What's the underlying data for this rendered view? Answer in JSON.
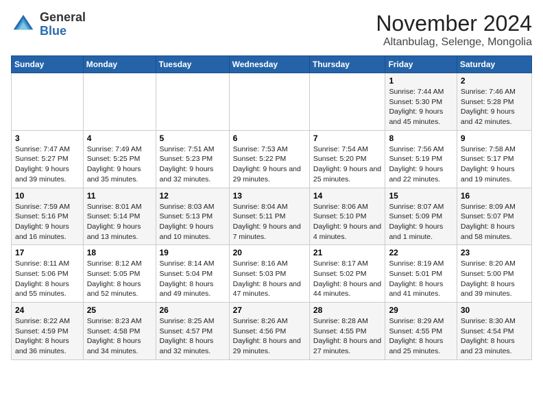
{
  "header": {
    "logo_line1": "General",
    "logo_line2": "Blue",
    "month": "November 2024",
    "location": "Altanbulag, Selenge, Mongolia"
  },
  "weekdays": [
    "Sunday",
    "Monday",
    "Tuesday",
    "Wednesday",
    "Thursday",
    "Friday",
    "Saturday"
  ],
  "weeks": [
    [
      {
        "day": "",
        "info": ""
      },
      {
        "day": "",
        "info": ""
      },
      {
        "day": "",
        "info": ""
      },
      {
        "day": "",
        "info": ""
      },
      {
        "day": "",
        "info": ""
      },
      {
        "day": "1",
        "info": "Sunrise: 7:44 AM\nSunset: 5:30 PM\nDaylight: 9 hours and 45 minutes."
      },
      {
        "day": "2",
        "info": "Sunrise: 7:46 AM\nSunset: 5:28 PM\nDaylight: 9 hours and 42 minutes."
      }
    ],
    [
      {
        "day": "3",
        "info": "Sunrise: 7:47 AM\nSunset: 5:27 PM\nDaylight: 9 hours and 39 minutes."
      },
      {
        "day": "4",
        "info": "Sunrise: 7:49 AM\nSunset: 5:25 PM\nDaylight: 9 hours and 35 minutes."
      },
      {
        "day": "5",
        "info": "Sunrise: 7:51 AM\nSunset: 5:23 PM\nDaylight: 9 hours and 32 minutes."
      },
      {
        "day": "6",
        "info": "Sunrise: 7:53 AM\nSunset: 5:22 PM\nDaylight: 9 hours and 29 minutes."
      },
      {
        "day": "7",
        "info": "Sunrise: 7:54 AM\nSunset: 5:20 PM\nDaylight: 9 hours and 25 minutes."
      },
      {
        "day": "8",
        "info": "Sunrise: 7:56 AM\nSunset: 5:19 PM\nDaylight: 9 hours and 22 minutes."
      },
      {
        "day": "9",
        "info": "Sunrise: 7:58 AM\nSunset: 5:17 PM\nDaylight: 9 hours and 19 minutes."
      }
    ],
    [
      {
        "day": "10",
        "info": "Sunrise: 7:59 AM\nSunset: 5:16 PM\nDaylight: 9 hours and 16 minutes."
      },
      {
        "day": "11",
        "info": "Sunrise: 8:01 AM\nSunset: 5:14 PM\nDaylight: 9 hours and 13 minutes."
      },
      {
        "day": "12",
        "info": "Sunrise: 8:03 AM\nSunset: 5:13 PM\nDaylight: 9 hours and 10 minutes."
      },
      {
        "day": "13",
        "info": "Sunrise: 8:04 AM\nSunset: 5:11 PM\nDaylight: 9 hours and 7 minutes."
      },
      {
        "day": "14",
        "info": "Sunrise: 8:06 AM\nSunset: 5:10 PM\nDaylight: 9 hours and 4 minutes."
      },
      {
        "day": "15",
        "info": "Sunrise: 8:07 AM\nSunset: 5:09 PM\nDaylight: 9 hours and 1 minute."
      },
      {
        "day": "16",
        "info": "Sunrise: 8:09 AM\nSunset: 5:07 PM\nDaylight: 8 hours and 58 minutes."
      }
    ],
    [
      {
        "day": "17",
        "info": "Sunrise: 8:11 AM\nSunset: 5:06 PM\nDaylight: 8 hours and 55 minutes."
      },
      {
        "day": "18",
        "info": "Sunrise: 8:12 AM\nSunset: 5:05 PM\nDaylight: 8 hours and 52 minutes."
      },
      {
        "day": "19",
        "info": "Sunrise: 8:14 AM\nSunset: 5:04 PM\nDaylight: 8 hours and 49 minutes."
      },
      {
        "day": "20",
        "info": "Sunrise: 8:16 AM\nSunset: 5:03 PM\nDaylight: 8 hours and 47 minutes."
      },
      {
        "day": "21",
        "info": "Sunrise: 8:17 AM\nSunset: 5:02 PM\nDaylight: 8 hours and 44 minutes."
      },
      {
        "day": "22",
        "info": "Sunrise: 8:19 AM\nSunset: 5:01 PM\nDaylight: 8 hours and 41 minutes."
      },
      {
        "day": "23",
        "info": "Sunrise: 8:20 AM\nSunset: 5:00 PM\nDaylight: 8 hours and 39 minutes."
      }
    ],
    [
      {
        "day": "24",
        "info": "Sunrise: 8:22 AM\nSunset: 4:59 PM\nDaylight: 8 hours and 36 minutes."
      },
      {
        "day": "25",
        "info": "Sunrise: 8:23 AM\nSunset: 4:58 PM\nDaylight: 8 hours and 34 minutes."
      },
      {
        "day": "26",
        "info": "Sunrise: 8:25 AM\nSunset: 4:57 PM\nDaylight: 8 hours and 32 minutes."
      },
      {
        "day": "27",
        "info": "Sunrise: 8:26 AM\nSunset: 4:56 PM\nDaylight: 8 hours and 29 minutes."
      },
      {
        "day": "28",
        "info": "Sunrise: 8:28 AM\nSunset: 4:55 PM\nDaylight: 8 hours and 27 minutes."
      },
      {
        "day": "29",
        "info": "Sunrise: 8:29 AM\nSunset: 4:55 PM\nDaylight: 8 hours and 25 minutes."
      },
      {
        "day": "30",
        "info": "Sunrise: 8:30 AM\nSunset: 4:54 PM\nDaylight: 8 hours and 23 minutes."
      }
    ]
  ]
}
